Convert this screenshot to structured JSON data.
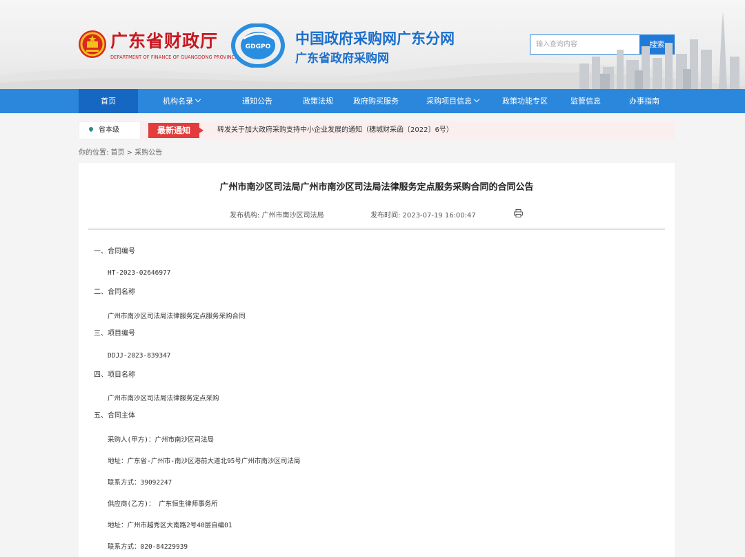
{
  "header": {
    "org_title": "广东省财政厅",
    "org_subtitle": "DEPARTMENT OF FINANCE OF GUANGDONG PROVINCE",
    "logo_text": "GDGPO",
    "site_title": "中国政府采购网广东分网",
    "site_subtitle": "广东省政府采购网",
    "search_placeholder": "输入查询内容",
    "search_button": "搜索"
  },
  "nav": {
    "items": [
      {
        "label": "首页",
        "active": true
      },
      {
        "label": "机构名录",
        "dropdown": true
      },
      {
        "label": "通知公告"
      },
      {
        "label": "政策法规"
      },
      {
        "label": "政府购买服务"
      },
      {
        "label": "采购项目信息",
        "dropdown": true
      },
      {
        "label": "政策功能专区"
      },
      {
        "label": "监管信息"
      },
      {
        "label": "办事指南"
      }
    ]
  },
  "notice": {
    "region": "省本级",
    "tag": "最新通知",
    "text": "转发关于加大政府采购支持中小企业发展的通知（穗城财采函〔2022〕6号）"
  },
  "breadcrumb": "你的位置:  首页 > 采购公告",
  "article": {
    "title": "广州市南沙区司法局广州市南沙区司法局法律服务定点服务采购合同的合同公告",
    "publisher": "发布机构:  广州市南沙区司法局",
    "publish_time": "发布时间:  2023-07-19 16:00:47",
    "sections": {
      "s1_heading": "一、合同编号",
      "s1_value": "HT-2023-02646977",
      "s2_heading": "二、合同名称",
      "s2_value": "广州市南沙区司法局法律服务定点服务采购合同",
      "s3_heading": "三、项目编号",
      "s3_value": "DDJJ-2023-839347",
      "s4_heading": "四、项目名称",
      "s4_value": "广州市南沙区司法局法律服务定点采购",
      "s5_heading": "五、合同主体",
      "buyer": "采购人(甲方)：广州市南沙区司法局",
      "buyer_address": "地址：广东省-广州市-南沙区港前大道北95号广州市南沙区司法局",
      "buyer_phone": "联系方式：39092247",
      "supplier": "供应商(乙方)：  广东恒生律师事务所",
      "supplier_address": "地址：广州市越秀区大南路2号40层自编01",
      "supplier_phone": "联系方式：020-84229939"
    }
  },
  "colors": {
    "brand_red": "#c8161e",
    "brand_blue": "#1a6ecc",
    "nav_blue": "#2b87dc",
    "nav_active": "#1667c2",
    "tag_red": "#e23c3c"
  },
  "icons": {
    "emblem": "national-emblem-icon",
    "logo": "gdgpo-logo",
    "pin": "location-pin-icon",
    "print": "print-icon",
    "dropdown": "chevron-down-icon"
  }
}
